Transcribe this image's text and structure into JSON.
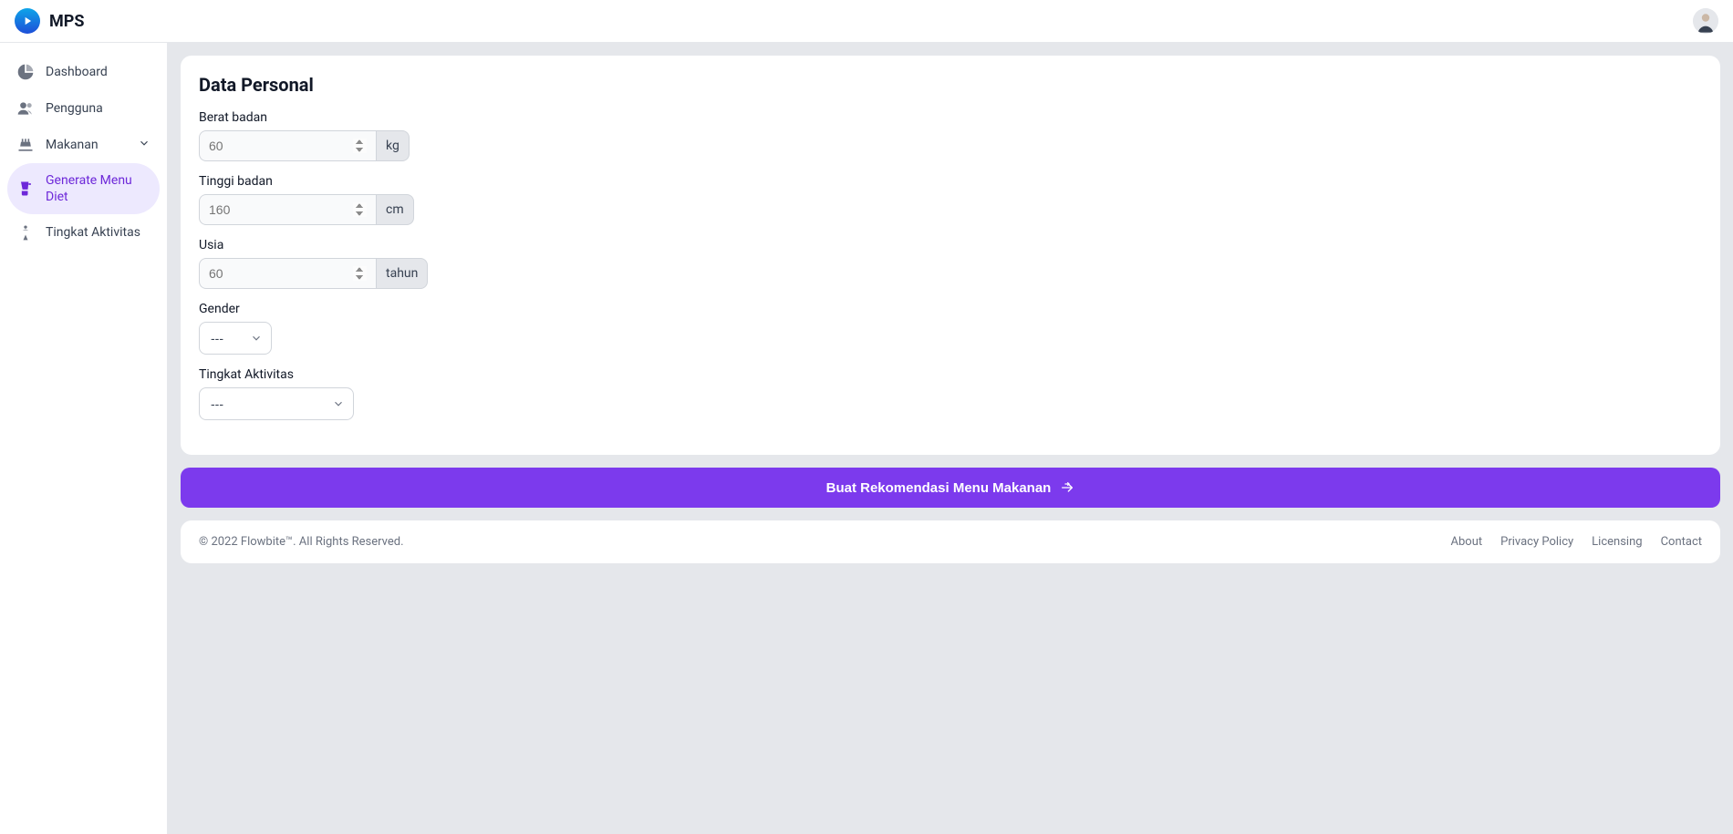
{
  "header": {
    "app_name": "MPS"
  },
  "sidebar": {
    "items": [
      {
        "label": "Dashboard"
      },
      {
        "label": "Pengguna"
      },
      {
        "label": "Makanan"
      },
      {
        "label": "Generate Menu Diet"
      },
      {
        "label": "Tingkat Aktivitas"
      }
    ]
  },
  "form": {
    "title": "Data Personal",
    "weight_label": "Berat badan",
    "weight_placeholder": "60",
    "weight_unit": "kg",
    "height_label": "Tinggi badan",
    "height_placeholder": "160",
    "height_unit": "cm",
    "age_label": "Usia",
    "age_placeholder": "60",
    "age_unit": "tahun",
    "gender_label": "Gender",
    "gender_placeholder": "---",
    "activity_label": "Tingkat Aktivitas",
    "activity_placeholder": "---"
  },
  "action": {
    "submit_label": "Buat Rekomendasi Menu Makanan"
  },
  "footer": {
    "copyright": "© 2022 Flowbite™. All Rights Reserved.",
    "links": {
      "about": "About",
      "privacy": "Privacy Policy",
      "licensing": "Licensing",
      "contact": "Contact"
    }
  }
}
